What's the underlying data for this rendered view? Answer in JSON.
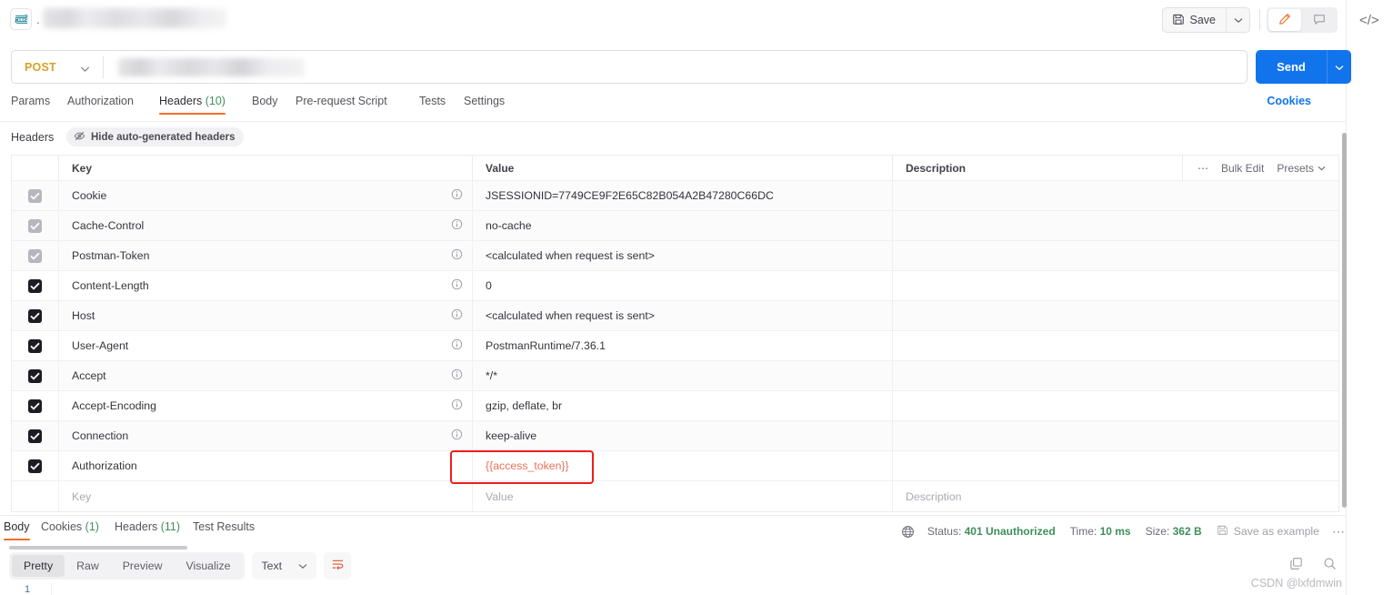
{
  "topbar": {
    "request_type_icon": "http-badge-icon",
    "title_separator": ".",
    "save_label": "Save",
    "save_icon": "floppy-disk-icon",
    "save_caret_icon": "chevron-down-icon",
    "edit_icon": "pencil-icon",
    "comment_icon": "comment-icon",
    "code_icon": "code-brackets-icon"
  },
  "url_bar": {
    "method": "POST",
    "method_caret_icon": "chevron-down-icon",
    "url_value": "",
    "send_label": "Send",
    "send_caret_icon": "chevron-down-icon"
  },
  "request_tabs": [
    {
      "label": "Params",
      "count": "",
      "active": false
    },
    {
      "label": "Authorization",
      "count": "",
      "active": false
    },
    {
      "label": "Headers",
      "count": "(10)",
      "active": true
    },
    {
      "label": "Body",
      "count": "",
      "active": false
    },
    {
      "label": "Pre-request Script",
      "count": "",
      "active": false
    },
    {
      "label": "Tests",
      "count": "",
      "active": false
    },
    {
      "label": "Settings",
      "count": "",
      "active": false
    }
  ],
  "cookies_link": "Cookies",
  "headers_toolbar": {
    "label": "Headers",
    "hide_auto_label": "Hide auto-generated headers",
    "hide_auto_icon": "eye-off-icon"
  },
  "table": {
    "columns": [
      "Key",
      "Value",
      "Description"
    ],
    "actions": {
      "more_icon": "ellipsis-icon",
      "bulk_edit": "Bulk Edit",
      "presets": "Presets",
      "presets_caret_icon": "chevron-down-icon"
    },
    "info_icon": "info-circle-icon",
    "check_icon": "checkmark-icon",
    "rows": [
      {
        "checked": true,
        "disabled": true,
        "key": "Cookie",
        "value": "JSESSIONID=7749CE9F2E65C82B054A2B47280C66DC",
        "description": "",
        "has_info": true,
        "highlight": false
      },
      {
        "checked": true,
        "disabled": true,
        "key": "Cache-Control",
        "value": "no-cache",
        "description": "",
        "has_info": true,
        "highlight": false
      },
      {
        "checked": true,
        "disabled": true,
        "key": "Postman-Token",
        "value": "<calculated when request is sent>",
        "description": "",
        "has_info": true,
        "highlight": false
      },
      {
        "checked": true,
        "disabled": false,
        "key": "Content-Length",
        "value": "0",
        "description": "",
        "has_info": true,
        "highlight": false
      },
      {
        "checked": true,
        "disabled": false,
        "key": "Host",
        "value": "<calculated when request is sent>",
        "description": "",
        "has_info": true,
        "highlight": false
      },
      {
        "checked": true,
        "disabled": false,
        "key": "User-Agent",
        "value": "PostmanRuntime/7.36.1",
        "description": "",
        "has_info": true,
        "highlight": false
      },
      {
        "checked": true,
        "disabled": false,
        "key": "Accept",
        "value": "*/*",
        "description": "",
        "has_info": true,
        "highlight": false
      },
      {
        "checked": true,
        "disabled": false,
        "key": "Accept-Encoding",
        "value": "gzip, deflate, br",
        "description": "",
        "has_info": true,
        "highlight": false
      },
      {
        "checked": true,
        "disabled": false,
        "key": "Connection",
        "value": "keep-alive",
        "description": "",
        "has_info": true,
        "highlight": false
      },
      {
        "checked": true,
        "disabled": false,
        "key": "Authorization",
        "value": "{{access_token}}",
        "description": "",
        "has_info": false,
        "highlight": true
      }
    ],
    "empty_row": {
      "key_placeholder": "Key",
      "value_placeholder": "Value",
      "description_placeholder": "Description"
    }
  },
  "response": {
    "tabs": [
      {
        "label": "Body",
        "count": "",
        "active": true
      },
      {
        "label": "Cookies",
        "count": "(1)",
        "active": false
      },
      {
        "label": "Headers",
        "count": "(11)",
        "active": false
      },
      {
        "label": "Test Results",
        "count": "",
        "active": false
      }
    ],
    "globe_icon": "globe-icon",
    "status_label": "Status:",
    "status_value": "401 Unauthorized",
    "time_label": "Time:",
    "time_value": "10 ms",
    "size_label": "Size:",
    "size_value": "362 B",
    "save_example_label": "Save as example",
    "save_example_icon": "floppy-disk-icon",
    "more_icon": "ellipsis-icon",
    "view_modes": [
      {
        "label": "Pretty",
        "active": true
      },
      {
        "label": "Raw",
        "active": false
      },
      {
        "label": "Preview",
        "active": false
      },
      {
        "label": "Visualize",
        "active": false
      }
    ],
    "format_value": "Text",
    "format_caret_icon": "chevron-down-icon",
    "wrap_icon": "wrap-lines-icon",
    "line_number": "1",
    "copy_icon": "copy-icon",
    "search_icon": "search-icon"
  },
  "watermark": "CSDN @lxfdmwin",
  "colors": {
    "accent_orange": "#f06f28",
    "send_blue": "#1174ec",
    "method_amber": "#d6a12a",
    "status_green": "#3f8f5c",
    "annotation_red": "#f01c1c",
    "token_red": "#e8705a"
  }
}
